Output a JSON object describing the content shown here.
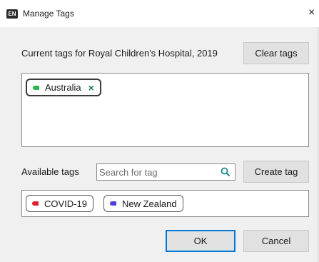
{
  "window": {
    "icon_text": "EN",
    "title": "Manage Tags",
    "close_glyph": "×"
  },
  "current": {
    "label": "Current tags for Royal Children's Hospital, 2019",
    "clear_button": "Clear tags",
    "tags": [
      {
        "name": "Australia",
        "color": "#2db84d",
        "removable": true,
        "remove_glyph": "×"
      }
    ]
  },
  "available": {
    "label": "Available tags",
    "search_placeholder": "Search for tag",
    "search_value": "",
    "create_button": "Create tag",
    "tags": [
      {
        "name": "COVID-19",
        "color": "#e0202c"
      },
      {
        "name": "New Zealand",
        "color": "#4f3fe0"
      }
    ]
  },
  "footer": {
    "ok_button": "OK",
    "cancel_button": "Cancel"
  },
  "icons": {
    "search": "magnifier-icon",
    "close": "close-icon"
  },
  "colors": {
    "dialog_bg": "#f0f0f0",
    "button_bg": "#e1e1e1",
    "default_button_border": "#0078d7",
    "remove_x": "#1f7a5a",
    "search_icon": "#1b8a8a"
  }
}
